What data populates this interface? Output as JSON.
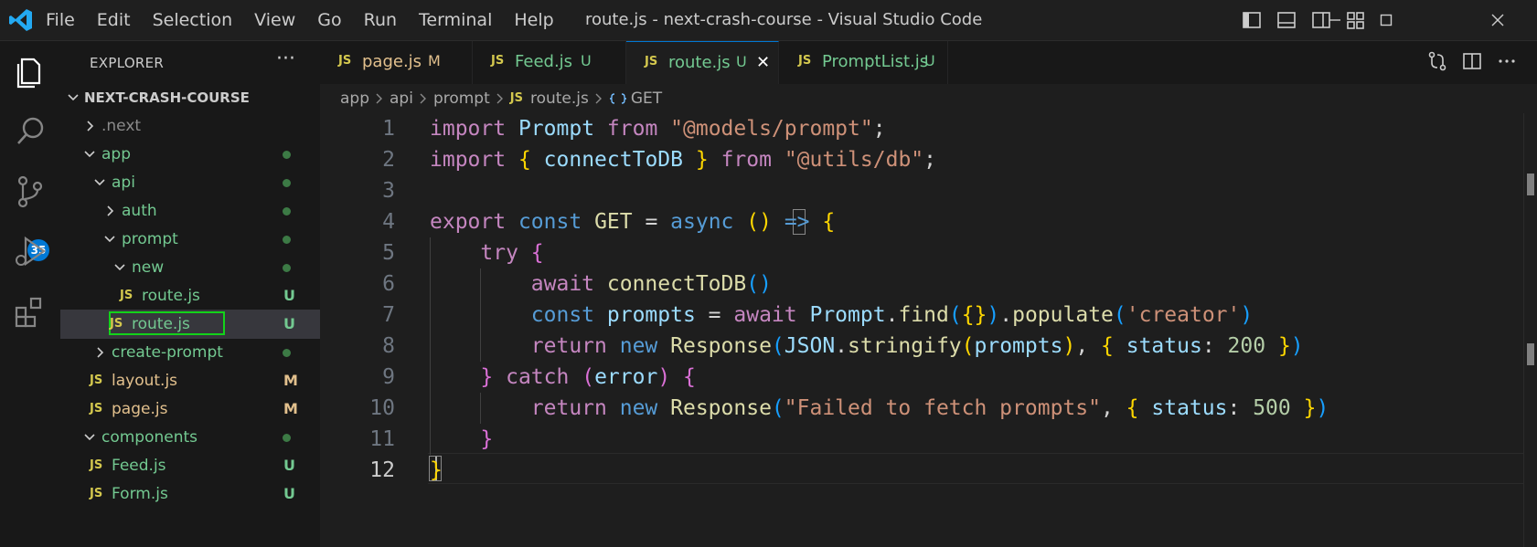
{
  "window": {
    "title": "route.js - next-crash-course - Visual Studio Code",
    "menu": [
      "File",
      "Edit",
      "Selection",
      "View",
      "Go",
      "Run",
      "Terminal",
      "Help"
    ]
  },
  "activity_bar": {
    "items": [
      "explorer-icon",
      "search-icon",
      "source-control-icon",
      "run-debug-icon",
      "extensions-icon"
    ],
    "source_control_badge": "35"
  },
  "sidebar": {
    "header": "EXPLORER",
    "more": "···",
    "root": "NEXT-CRASH-COURSE",
    "tree": [
      {
        "name": ".next",
        "status": ""
      },
      {
        "name": "app",
        "status": "dot"
      },
      {
        "name": "api",
        "status": "dot"
      },
      {
        "name": "auth",
        "status": "dot"
      },
      {
        "name": "prompt",
        "status": "dot"
      },
      {
        "name": "new",
        "status": "dot"
      },
      {
        "name": "route.js",
        "status": "U",
        "js": "JS"
      },
      {
        "name": "route.js",
        "status": "U",
        "js": "JS"
      },
      {
        "name": "create-prompt",
        "status": "dot"
      },
      {
        "name": "layout.js",
        "status": "M",
        "js": "JS"
      },
      {
        "name": "page.js",
        "status": "M",
        "js": "JS"
      },
      {
        "name": "components",
        "status": "dot"
      },
      {
        "name": "Feed.js",
        "status": "U",
        "js": "JS"
      },
      {
        "name": "Form.js",
        "status": "U",
        "js": "JS"
      }
    ]
  },
  "tabs": [
    {
      "label": "page.js",
      "status": "M",
      "icon": "JS"
    },
    {
      "label": "Feed.js",
      "status": "U",
      "icon": "JS"
    },
    {
      "label": "route.js",
      "status": "U",
      "icon": "JS",
      "close": "✕"
    },
    {
      "label": "PromptList.js",
      "status": "U",
      "icon": "JS"
    }
  ],
  "breadcrumb": {
    "parts": [
      "app",
      "api",
      "prompt"
    ],
    "file": "route.js",
    "file_icon": "JS",
    "symbol": "GET"
  },
  "editor": {
    "line_numbers": [
      "1",
      "2",
      "3",
      "4",
      "5",
      "6",
      "7",
      "8",
      "9",
      "10",
      "11",
      "12"
    ],
    "current_line": "12",
    "tokens": {
      "import": "import",
      "from": "from",
      "export": "export",
      "const": "const",
      "async": "async",
      "arrow": "=>",
      "try": "try",
      "await": "await",
      "return": "return",
      "new": "new",
      "catch": "catch",
      "Prompt": "Prompt",
      "connectToDB": "connectToDB",
      "GET": "GET",
      "prompts": "prompts",
      "find": "find",
      "populate": "populate",
      "Response": "Response",
      "JSON": "JSON",
      "stringify": "stringify",
      "status": "status",
      "error": "error",
      "str_models": "\"@models/prompt\"",
      "str_utils": "\"@utils/db\"",
      "str_creator": "'creator'",
      "str_failed": "\"Failed to fetch prompts\"",
      "num_200": "200",
      "num_500": "500"
    }
  }
}
